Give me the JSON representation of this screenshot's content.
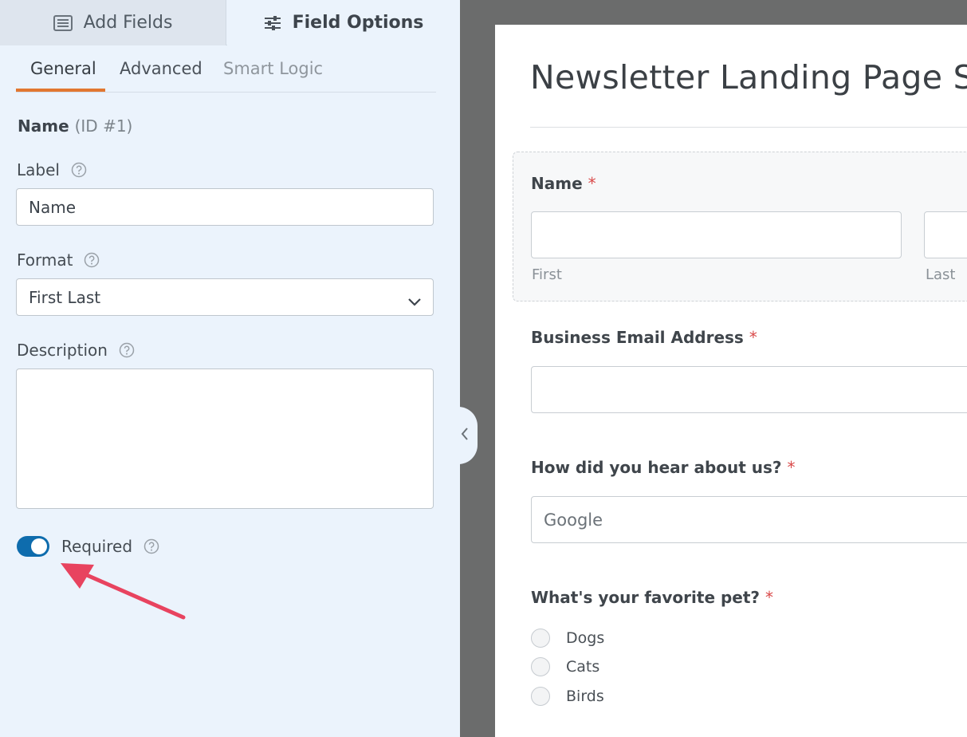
{
  "tabs": {
    "add_fields": "Add Fields",
    "field_options": "Field Options"
  },
  "subtabs": {
    "general": "General",
    "advanced": "Advanced",
    "smart_logic": "Smart Logic"
  },
  "field": {
    "name": "Name",
    "id": "(ID #1)"
  },
  "options": {
    "label_title": "Label",
    "label_value": "Name",
    "format_title": "Format",
    "format_value": "First Last",
    "description_title": "Description",
    "description_value": "",
    "required_label": "Required",
    "required_on": true
  },
  "preview": {
    "title": "Newsletter Landing Page Signup",
    "name_label": "Name",
    "required_mark": "*",
    "first_label": "First",
    "last_label": "Last",
    "email_label": "Business Email Address",
    "hear_label": "How did you hear about us?",
    "hear_value": "Google",
    "pet_label": "What's your favorite pet?",
    "pet_options": [
      "Dogs",
      "Cats",
      "Birds"
    ]
  },
  "colors": {
    "accent_tab": "#e27730",
    "toggle_on": "#0e6cad",
    "annotation_arrow": "#e8435f",
    "required_star": "#d94a4a"
  },
  "icons": {
    "add_fields": "list-icon",
    "field_options": "sliders-icon",
    "help": "question-circle-icon",
    "format_dropdown": "chevron-down-icon",
    "collapse": "chevron-left-icon"
  }
}
